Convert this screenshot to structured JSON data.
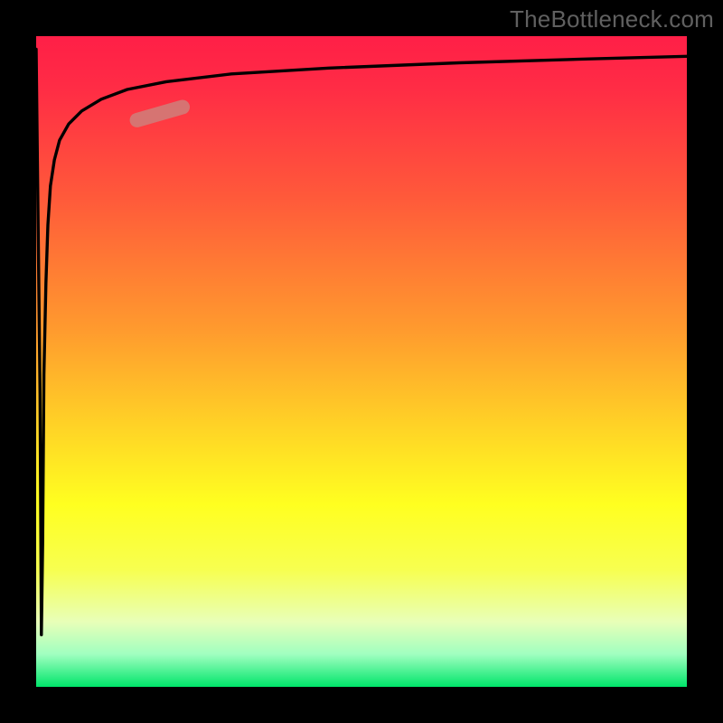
{
  "watermark": "TheBottleneck.com",
  "chart_data": {
    "type": "line",
    "title": "",
    "xlabel": "",
    "ylabel": "",
    "xlim": [
      0,
      100
    ],
    "ylim": [
      0,
      100
    ],
    "grid": false,
    "legend": false,
    "background_gradient_stops": [
      {
        "pos": 0,
        "color": "#ff1f47"
      },
      {
        "pos": 25,
        "color": "#ff5a3a"
      },
      {
        "pos": 45,
        "color": "#ff9a2e"
      },
      {
        "pos": 60,
        "color": "#ffd326"
      },
      {
        "pos": 72,
        "color": "#ffff20"
      },
      {
        "pos": 90,
        "color": "#e8ffb8"
      },
      {
        "pos": 100,
        "color": "#00e56a"
      }
    ],
    "series": [
      {
        "name": "bottleneck-curve",
        "color": "#000000",
        "x": [
          0,
          0.6,
          0.8,
          1.0,
          1.2,
          1.5,
          1.8,
          2.2,
          2.8,
          3.6,
          5,
          7,
          10,
          14,
          20,
          30,
          45,
          65,
          85,
          100
        ],
        "y": [
          98,
          45,
          8,
          22,
          48,
          62,
          71,
          77,
          81,
          84,
          86.5,
          88.5,
          90.3,
          91.8,
          93.0,
          94.2,
          95.1,
          95.9,
          96.5,
          96.9
        ]
      }
    ],
    "annotations": [
      {
        "name": "highlight-segment",
        "type": "band",
        "color": "#cf7f7a",
        "x_range": [
          15.5,
          22.5
        ],
        "y_range": [
          87.1,
          89.1
        ],
        "opacity": 0.85
      }
    ]
  }
}
